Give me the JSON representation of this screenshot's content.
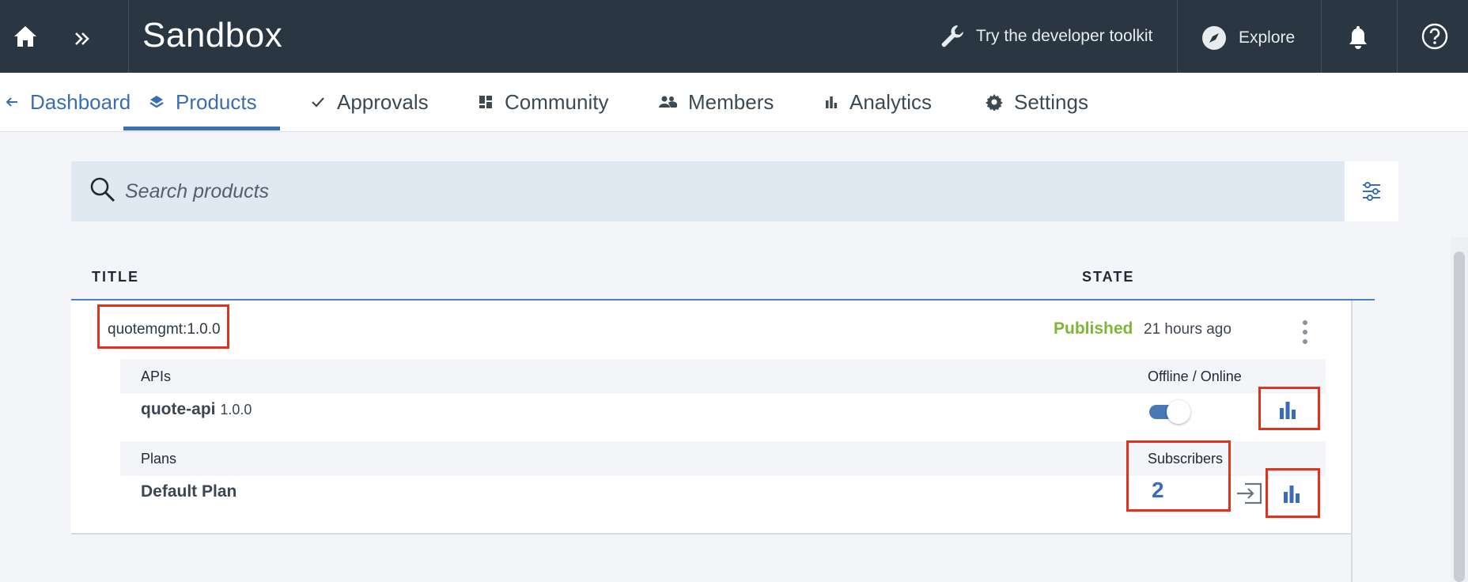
{
  "header": {
    "home_icon": "home-icon",
    "expand_icon": "double-chevron-right-icon",
    "title": "Sandbox",
    "toolkit_label": "Try the developer toolkit",
    "toolkit_icon": "wrench-icon",
    "explore_label": "Explore",
    "explore_icon": "compass-icon",
    "notifications_icon": "bell-icon",
    "help_icon": "help-icon"
  },
  "nav": {
    "back_label": "Dashboard",
    "tabs": [
      {
        "label": "Products",
        "icon": "layers-icon",
        "active": true
      },
      {
        "label": "Approvals",
        "icon": "checkmark-icon",
        "active": false
      },
      {
        "label": "Community",
        "icon": "dashboard-icon",
        "active": false
      },
      {
        "label": "Members",
        "icon": "people-icon",
        "active": false
      },
      {
        "label": "Analytics",
        "icon": "bar-chart-icon",
        "active": false
      },
      {
        "label": "Settings",
        "icon": "gear-icon",
        "active": false
      }
    ]
  },
  "search": {
    "placeholder": "Search products",
    "filter_icon": "sliders-icon"
  },
  "table": {
    "columns": [
      "TITLE",
      "STATE"
    ],
    "product": {
      "name": "quotemgmt:1.0.0",
      "state": "Published",
      "updated": "21 hours ago",
      "apis_label": "APIs",
      "offline_online_label": "Offline / Online",
      "api": {
        "name": "quote-api",
        "version": "1.0.0",
        "online": true
      },
      "plans_label": "Plans",
      "subscribers_label": "Subscribers",
      "plan": {
        "name": "Default Plan",
        "subscribers": "2"
      }
    }
  },
  "colors": {
    "header_bg": "#2a3641",
    "accent": "#3a6db5",
    "published": "#7fb638",
    "highlight_box": "#e0321c"
  }
}
